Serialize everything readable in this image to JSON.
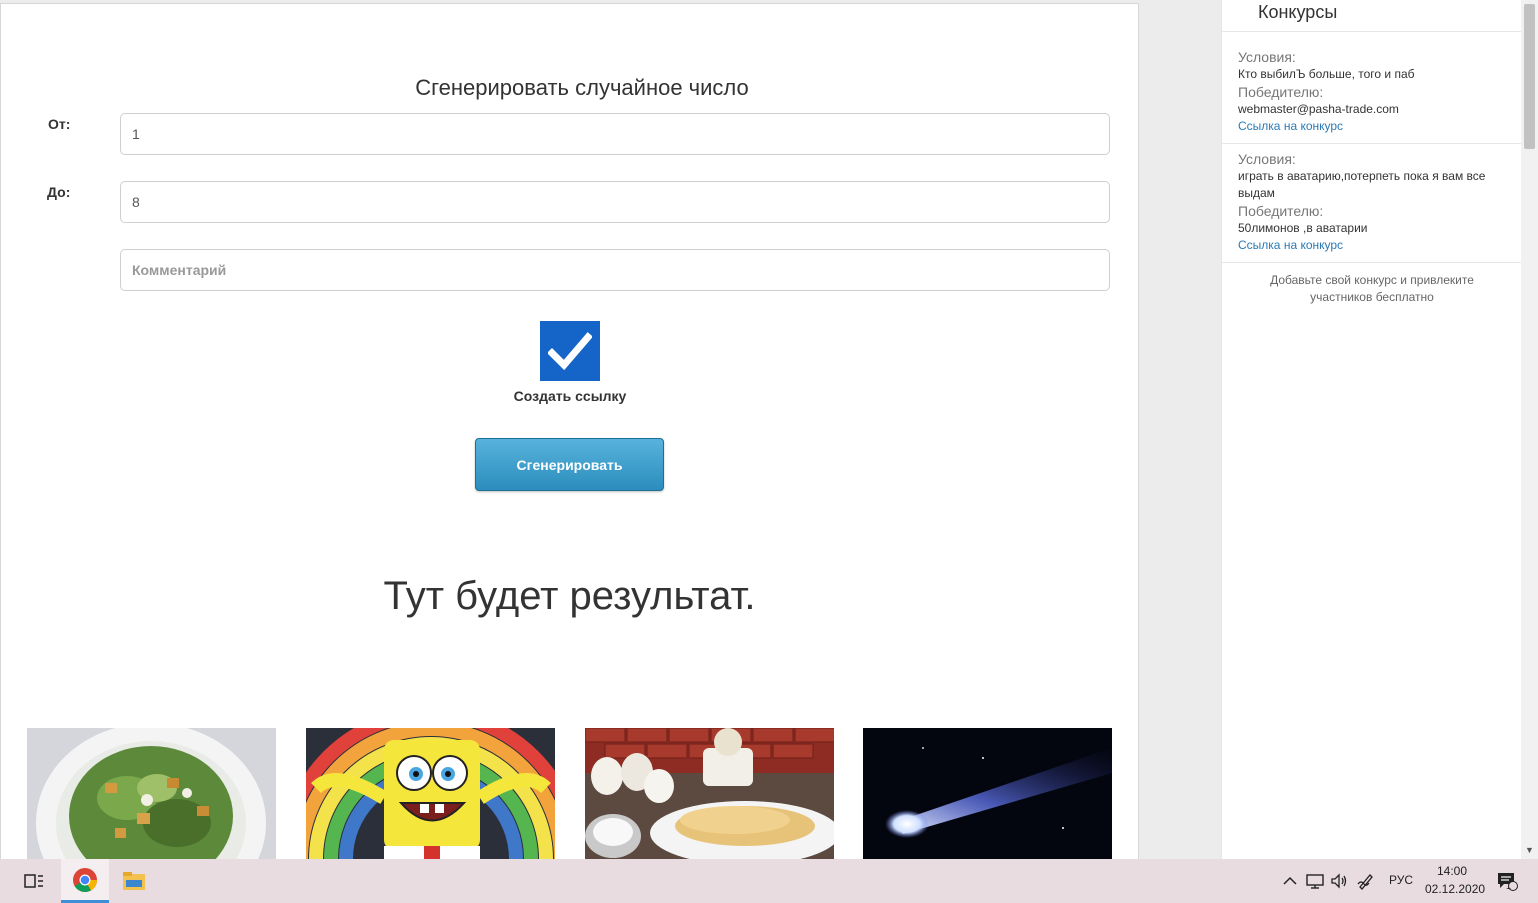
{
  "form": {
    "title": "Сгенерировать случайное число",
    "from_label": "От:",
    "from_value": "1",
    "to_label": "До:",
    "to_value": "8",
    "comment_placeholder": "Комментарий",
    "create_link_checked": true,
    "create_link_label": "Создать ссылку",
    "generate_button": "Сгенерировать"
  },
  "result": {
    "text": "Тут будет результат."
  },
  "thumbnails": [
    {
      "name": "salad"
    },
    {
      "name": "spongebob"
    },
    {
      "name": "pancakes"
    },
    {
      "name": "comet"
    }
  ],
  "sidebar": {
    "title": "Конкурсы",
    "contests": [
      {
        "conditions_label": "Условия:",
        "conditions": "Кто выбилЪ больше, того и паб",
        "winner_label": "Победителю:",
        "winner": "webmaster@pasha-trade.com",
        "link": "Ссылка на конкурс"
      },
      {
        "conditions_label": "Условия:",
        "conditions": "играть в аватарию,потерпеть пока я вам все выдам",
        "winner_label": "Победителю:",
        "winner": "50лимонов ,в аватарии",
        "link": "Ссылка на конкурс"
      }
    ],
    "footer": "Добавьте свой конкурс и привлеките участников бесплатно"
  },
  "taskbar": {
    "language": "РУС",
    "time": "14:00",
    "date": "02.12.2020",
    "notification_count": "1"
  }
}
